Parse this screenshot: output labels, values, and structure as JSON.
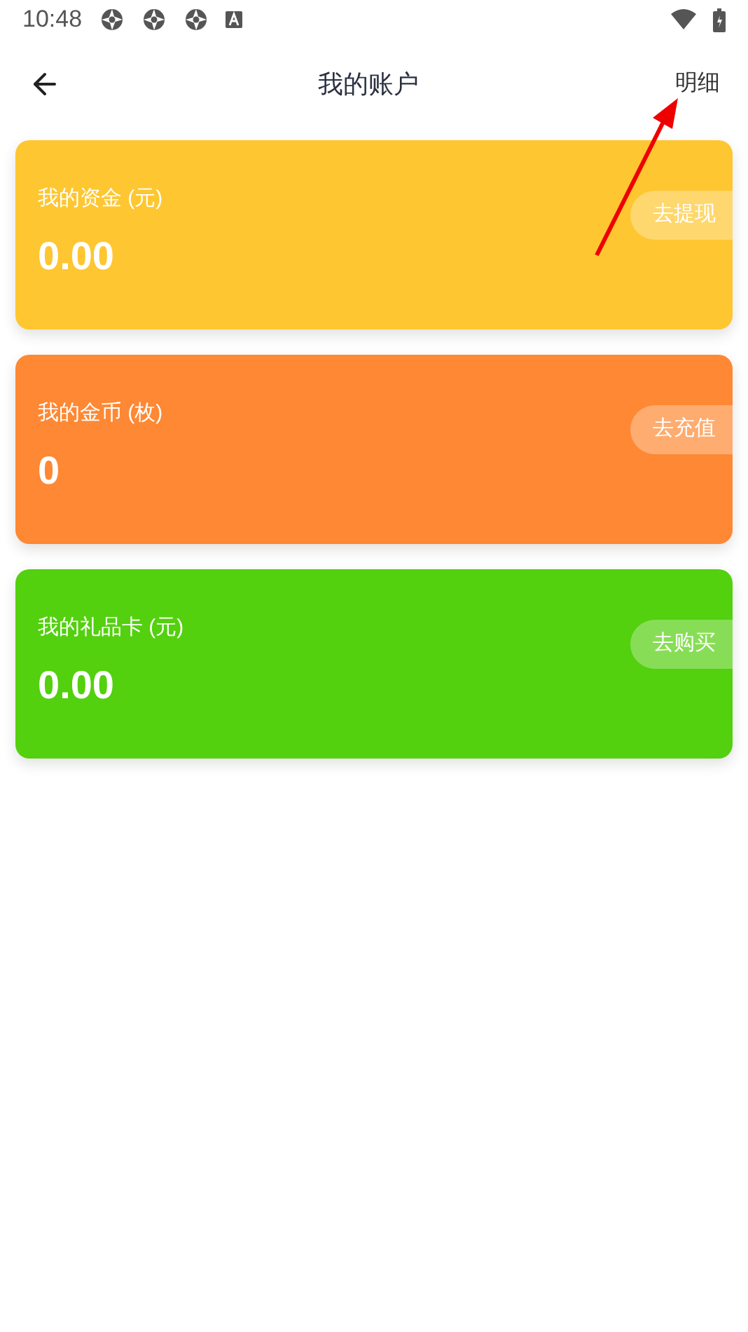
{
  "status_bar": {
    "time": "10:48"
  },
  "header": {
    "title": "我的账户",
    "action": "明细"
  },
  "accounts": [
    {
      "label": "我的资金 (元)",
      "amount": "0.00",
      "button": "去提现",
      "color": "#fec630"
    },
    {
      "label": "我的金币 (枚)",
      "amount": "0",
      "button": "去充值",
      "color": "#fe8833"
    },
    {
      "label": "我的礼品卡 (元)",
      "amount": "0.00",
      "button": "去购买",
      "color": "#53d00e"
    }
  ]
}
